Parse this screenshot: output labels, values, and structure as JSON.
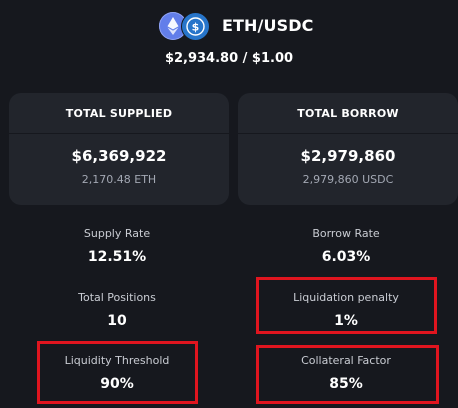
{
  "pair": {
    "icons": [
      "ethereum-icon",
      "usdc-icon"
    ],
    "title": "ETH/USDC",
    "price": "$2,934.80 / $1.00"
  },
  "cards": {
    "supplied": {
      "title": "TOTAL SUPPLIED",
      "value": "$6,369,922",
      "sub": "2,170.48 ETH"
    },
    "borrow": {
      "title": "TOTAL BORROW",
      "value": "$2,979,860",
      "sub": "2,979,860 USDC"
    }
  },
  "stats": {
    "supply_rate": {
      "label": "Supply Rate",
      "value": "12.51%"
    },
    "borrow_rate": {
      "label": "Borrow Rate",
      "value": "6.03%"
    },
    "total_positions": {
      "label": "Total Positions",
      "value": "10"
    },
    "liquidation_penalty": {
      "label": "Liquidation penalty",
      "value": "1%"
    },
    "liquidity_threshold": {
      "label": "Liquidity Threshold",
      "value": "90%"
    },
    "collateral_factor": {
      "label": "Collateral Factor",
      "value": "85%"
    }
  },
  "colors": {
    "background": "#16181e",
    "card": "#22252c",
    "eth": "#627eea",
    "usdc": "#2775ca",
    "highlight": "#e0151f"
  }
}
